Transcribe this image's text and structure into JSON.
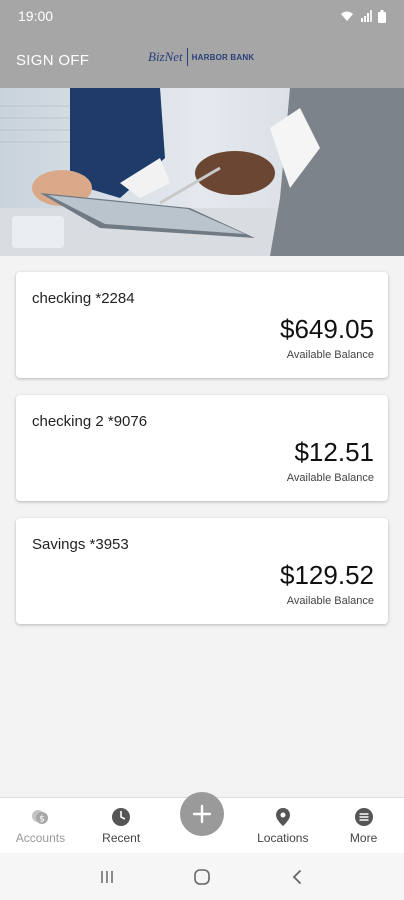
{
  "status_bar": {
    "time": "19:00"
  },
  "header": {
    "sign_off_label": "SIGN OFF",
    "logo_left": "BizNet",
    "logo_right": "HARBOR BANK"
  },
  "accounts": [
    {
      "name": "checking *2284",
      "balance": "$649.05",
      "balance_label": "Available Balance"
    },
    {
      "name": "checking 2 *9076",
      "balance": "$12.51",
      "balance_label": "Available Balance"
    },
    {
      "name": "Savings *3953",
      "balance": "$129.52",
      "balance_label": "Available Balance"
    }
  ],
  "bottom_nav": {
    "items": [
      {
        "label": "Accounts",
        "icon": "accounts-coins-icon"
      },
      {
        "label": "Recent",
        "icon": "clock-icon"
      },
      {
        "label": "",
        "icon": "plus-icon"
      },
      {
        "label": "Locations",
        "icon": "location-pin-icon"
      },
      {
        "label": "More",
        "icon": "menu-circle-icon"
      }
    ]
  },
  "colors": {
    "header_bg": "#a6a6a6",
    "brand_navy": "#2a3f7a",
    "fab": "#9a9a9a"
  }
}
